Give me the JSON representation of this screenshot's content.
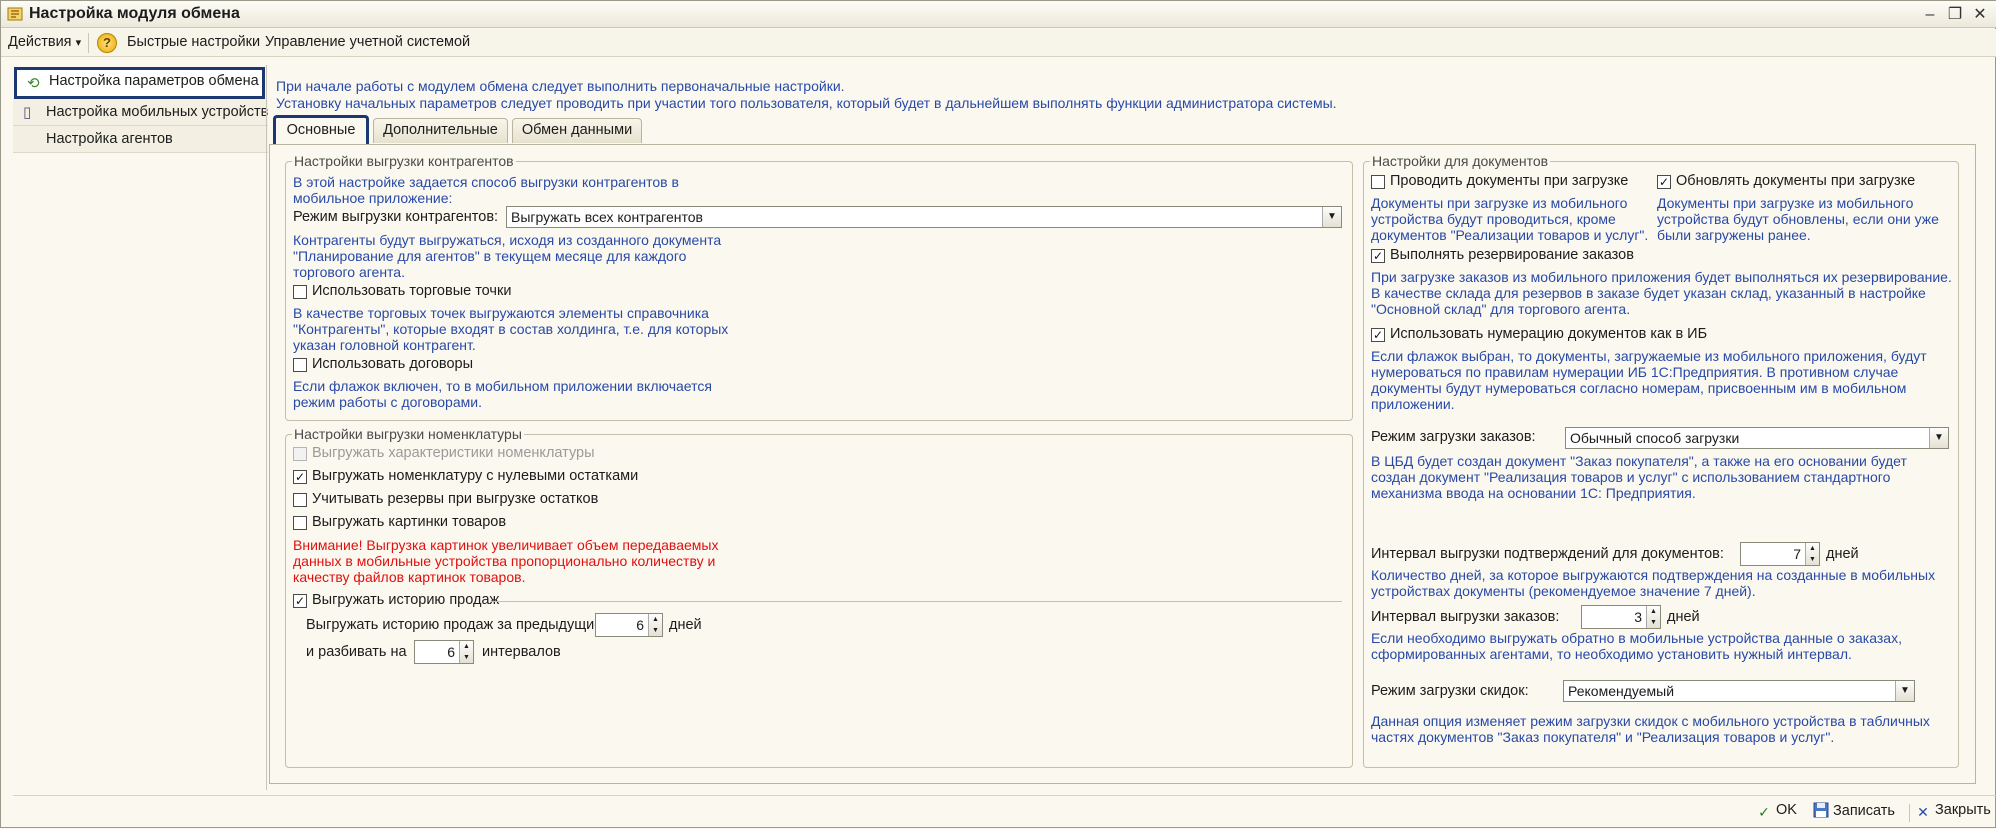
{
  "window": {
    "title": "Настройка модуля обмена",
    "controls": {
      "minimize": "–",
      "maximize": "❐",
      "close": "✕"
    }
  },
  "menu": {
    "actions": "Действия",
    "actions_arrow": "▾",
    "help_glyph": "?",
    "quick_settings": "Быстрые настройки",
    "accounting_mgmt": "Управление учетной системой"
  },
  "sidebar": {
    "items": [
      {
        "label": "Настройка параметров обмена",
        "icon": "refresh-icon",
        "active": true
      },
      {
        "label": "Настройка мобильных устройств",
        "icon": "mobile-device-icon",
        "active": false
      },
      {
        "label": "Настройка агентов",
        "icon": "",
        "active": false
      }
    ]
  },
  "info": {
    "line1": "При начале работы с модулем обмена следует выполнить первоначальные настройки.",
    "line2": "Установку начальных параметров следует проводить при участии того пользователя, который будет в дальнейшем выполнять функции администратора системы."
  },
  "tabs": [
    {
      "label": "Основные",
      "active": true
    },
    {
      "label": "Дополнительные",
      "active": false
    },
    {
      "label": "Обмен данными",
      "active": false
    }
  ],
  "contractors": {
    "legend": "Настройки выгрузки контрагентов",
    "desc1": "В этой настройке задается способ выгрузки контрагентов в",
    "desc2": "мобильное приложение:",
    "mode_label": "Режим выгрузки контрагентов:",
    "mode_value": "Выгружать всех контрагентов",
    "mode_desc1": "Контрагенты будут выгружаться, исходя из созданного документа",
    "mode_desc2": "\"Планирование для агентов\" в текущем месяце для каждого",
    "mode_desc3": "торгового агента.",
    "outlets_label": "Использовать торговые точки",
    "outlets_checked": false,
    "outlets_desc1": "В качестве торговых точек выгружаются элементы справочника",
    "outlets_desc2": "\"Контрагенты\", которые входят в состав холдинга, т.е. для которых",
    "outlets_desc3": "указан головной контрагент.",
    "contracts_label": "Использовать договоры",
    "contracts_checked": false,
    "contracts_desc1": "Если флажок включен, то в мобильном приложении включается",
    "contracts_desc2": "режим работы с договорами."
  },
  "nomenclature": {
    "legend": "Настройки выгрузки номенклатуры",
    "characteristics_label": "Выгружать характеристики номенклатуры",
    "characteristics_checked": false,
    "zero_stock_label": "Выгружать номенклатуру с нулевыми остатками",
    "zero_stock_checked": true,
    "reserves_label": "Учитывать резервы при выгрузке остатков",
    "reserves_checked": false,
    "images_label": "Выгружать картинки товаров",
    "images_checked": false,
    "warning1": "Внимание! Выгрузка картинок увеличивает объем передаваемых",
    "warning2": "данных в мобильные устройства пропорционально количеству и",
    "warning3": "качеству файлов картинок товаров.",
    "history_label": "Выгружать историю продаж",
    "history_checked": true,
    "history_prev_label": "Выгружать историю продаж за предыдущие",
    "history_prev_value": "6",
    "history_prev_unit": "дней",
    "intervals_label": "и разбивать на",
    "intervals_value": "6",
    "intervals_unit": "интервалов"
  },
  "documents": {
    "legend": "Настройки для документов",
    "post_label": "Проводить документы при загрузке",
    "post_checked": false,
    "post_desc1": "Документы при загрузке из мобильного",
    "post_desc2": "устройства будут проводиться, кроме",
    "post_desc3": "документов \"Реализации товаров и услуг\".",
    "update_label": "Обновлять документы при загрузке",
    "update_checked": true,
    "update_desc1": "Документы при загрузке из мобильного",
    "update_desc2": "устройства будут обновлены, если они уже",
    "update_desc3": "были загружены ранее.",
    "reserve_label": "Выполнять резервирование заказов",
    "reserve_checked": true,
    "reserve_desc1": "При загрузке заказов из мобильного приложения будет выполняться их резервирование.",
    "reserve_desc2": "В качестве склада для резервов в заказе будет указан склад, указанный в настройке",
    "reserve_desc3": "\"Основной склад\" для торгового агента.",
    "numbering_label": "Использовать нумерацию документов как в ИБ",
    "numbering_checked": true,
    "numbering_desc1": "Если флажок выбран, то документы, загружаемые из мобильного приложения, будут",
    "numbering_desc2": "нумероваться по правилам нумерации ИБ 1С:Предприятия.  В противном случае",
    "numbering_desc3": "документы будут нумероваться согласно номерам, присвоенным им в мобильном",
    "numbering_desc4": "приложении.",
    "orders_mode_label": "Режим загрузки заказов:",
    "orders_mode_value": "Обычный способ загрузки",
    "orders_mode_desc1": "В ЦБД будет создан документ \"Заказ покупателя\", а также на его основании будет",
    "orders_mode_desc2": "создан документ \"Реализация товаров и услуг\" с использованием стандартного",
    "orders_mode_desc3": "механизма ввода на основании 1С: Предприятия.",
    "confirm_interval_label": "Интервал выгрузки подтверждений для документов:",
    "confirm_interval_value": "7",
    "confirm_interval_unit": "дней",
    "confirm_interval_desc1": "Количество дней, за которое выгружаются подтверждения на созданные в мобильных",
    "confirm_interval_desc2": "устройствах документы (рекомендуемое значение 7 дней).",
    "orders_interval_label": "Интервал выгрузки заказов:",
    "orders_interval_value": "3",
    "orders_interval_unit": "дней",
    "orders_interval_desc1": "Если необходимо выгружать обратно в мобильные устройства данные о заказах,",
    "orders_interval_desc2": "сформированных агентами, то необходимо установить нужный интервал.",
    "discounts_mode_label": "Режим загрузки скидок:",
    "discounts_mode_value": "Рекомендуемый",
    "discounts_mode_desc1": "Данная опция изменяет режим загрузки скидок с мобильного устройства в табличных",
    "discounts_mode_desc2": "частях документов \"Заказ покупателя\" и \"Реализация товаров и услуг\"."
  },
  "footer": {
    "ok": "OK",
    "save": "Записать",
    "close": "Закрыть"
  },
  "glyphs": {
    "check": "✓",
    "dropdown": "▼",
    "spin_up": "▲",
    "spin_down": "▼"
  }
}
